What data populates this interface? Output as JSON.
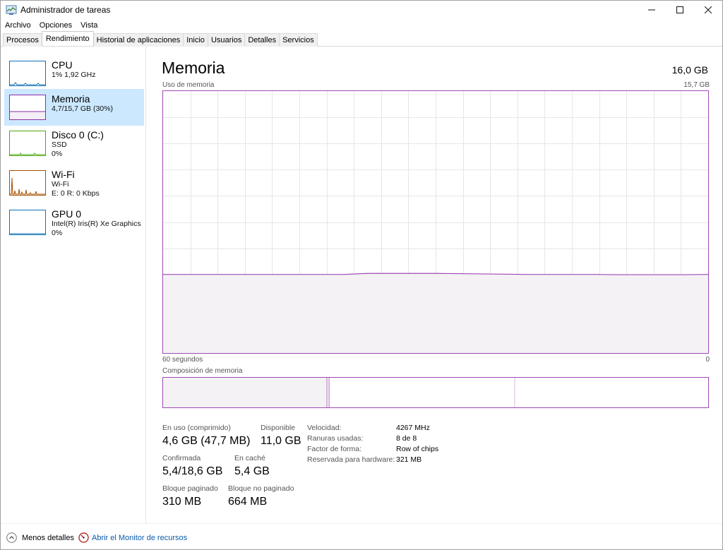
{
  "window": {
    "title": "Administrador de tareas",
    "controls": {
      "minimize": "—",
      "maximize": "☐",
      "close": "✕"
    }
  },
  "menu": [
    "Archivo",
    "Opciones",
    "Vista"
  ],
  "tabs": [
    "Procesos",
    "Rendimiento",
    "Historial de aplicaciones",
    "Inicio",
    "Usuarios",
    "Detalles",
    "Servicios"
  ],
  "active_tab": "Rendimiento",
  "sidebar": {
    "items": [
      {
        "title": "CPU",
        "line1": "1% 1,92 GHz",
        "line2": "",
        "color": "#1170b6",
        "icon": "cpu-thumbnail"
      },
      {
        "title": "Memoria",
        "line1": "4,7/15,7 GB (30%)",
        "line2": "",
        "color": "#8b2fa8",
        "icon": "memory-thumbnail",
        "selected": true
      },
      {
        "title": "Disco 0 (C:)",
        "line1": "SSD",
        "line2": "0%",
        "color": "#4da60c",
        "icon": "disk-thumbnail"
      },
      {
        "title": "Wi-Fi",
        "line1": "Wi-Fi",
        "line2": "E: 0 R: 0 Kbps",
        "color": "#a74f01",
        "icon": "wifi-thumbnail"
      },
      {
        "title": "GPU 0",
        "line1": "Intel(R) Iris(R) Xe Graphics",
        "line2": "0%",
        "color": "#1170b6",
        "icon": "gpu-thumbnail"
      }
    ]
  },
  "memory": {
    "title": "Memoria",
    "total": "16,0 GB",
    "usage_label": "Uso de memoria",
    "usage_max": "15,7 GB",
    "time_left": "60 segundos",
    "time_right": "0",
    "composition_label": "Composición de memoria",
    "usage_fraction": 0.3,
    "composition": {
      "in_use_fraction": 0.3,
      "modified_fraction": 0.005,
      "standby_fraction": 0.34
    },
    "accent_color": "#9f49b4",
    "fill_color": "#f4f2f5",
    "stats": {
      "in_use_label": "En uso (comprimido)",
      "in_use_value": "4,6 GB (47,7 MB)",
      "available_label": "Disponible",
      "available_value": "11,0 GB",
      "committed_label": "Confirmada",
      "committed_value": "5,4/18,6 GB",
      "cached_label": "En caché",
      "cached_value": "5,4 GB",
      "paged_label": "Bloque paginado",
      "paged_value": "310 MB",
      "nonpaged_label": "Bloque no paginado",
      "nonpaged_value": "664 MB"
    },
    "info": [
      {
        "label": "Velocidad:",
        "value": "4267 MHz"
      },
      {
        "label": "Ranuras usadas:",
        "value": "8 de 8"
      },
      {
        "label": "Factor de forma:",
        "value": "Row of chips"
      },
      {
        "label": "Reservada para hardware:",
        "value": "321 MB"
      }
    ]
  },
  "footer": {
    "less_details": "Menos detalles",
    "open_monitor": "Abrir el Monitor de recursos",
    "link_color": "#0b5cab"
  }
}
